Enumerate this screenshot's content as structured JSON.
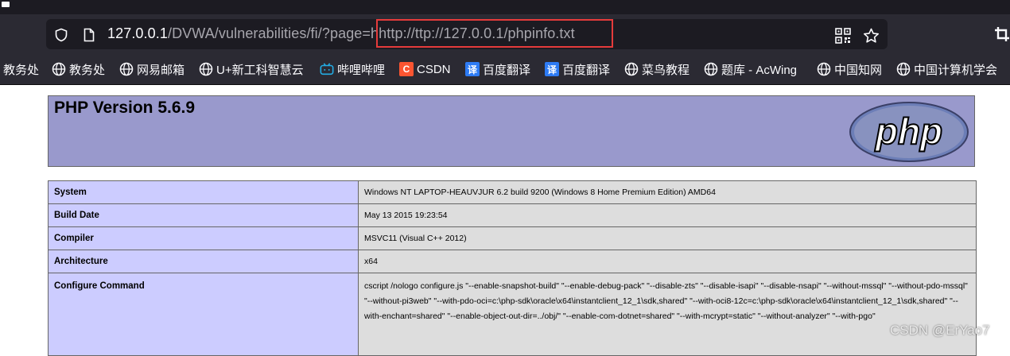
{
  "browser": {
    "url": {
      "host": "127.0.0.1",
      "path": "/DVWA/vulnerabilities/fi/?page=",
      "param": "hhttp://ttp://127.0.0.1/phpinfo.txt"
    },
    "icons": [
      "shield-icon",
      "page-icon",
      "qr-code-icon",
      "bookmark-star-icon",
      "screenshot-icon"
    ],
    "highlight_color": "#e53b3b"
  },
  "bookmarks": [
    {
      "label": "教务处",
      "icon": "none"
    },
    {
      "label": "教务处",
      "icon": "globe-icon"
    },
    {
      "label": "网易邮箱",
      "icon": "globe-icon"
    },
    {
      "label": "U+新工科智慧云",
      "icon": "globe-icon"
    },
    {
      "label": "哔哩哔哩",
      "icon": "bilibili-icon"
    },
    {
      "label": "CSDN",
      "icon": "csdn-icon"
    },
    {
      "label": "百度翻译",
      "icon": "translate-icon"
    },
    {
      "label": "百度翻译",
      "icon": "translate-icon"
    },
    {
      "label": "菜鸟教程",
      "icon": "globe-icon"
    },
    {
      "label": "题库 - AcWing",
      "icon": "globe-icon"
    },
    {
      "label": "中国知网",
      "icon": "globe-icon"
    },
    {
      "label": "中国计算机学会",
      "icon": "globe-icon"
    }
  ],
  "bookmark_glyphs": {
    "translate": "译",
    "csdn": "C"
  },
  "phpinfo": {
    "title": "PHP Version 5.6.9",
    "logo_text": "php",
    "header_color": "#9999cc",
    "rows": [
      {
        "key": "System",
        "value": "Windows NT LAPTOP-HEAUVJUR 6.2 build 9200 (Windows 8 Home Premium Edition) AMD64"
      },
      {
        "key": "Build Date",
        "value": "May 13 2015 19:23:54"
      },
      {
        "key": "Compiler",
        "value": "MSVC11 (Visual C++ 2012)"
      },
      {
        "key": "Architecture",
        "value": "x64"
      },
      {
        "key": "Configure Command",
        "value": "cscript /nologo configure.js \"--enable-snapshot-build\" \"--enable-debug-pack\" \"--disable-zts\" \"--disable-isapi\" \"--disable-nsapi\" \"--without-mssql\" \"--without-pdo-mssql\" \"--without-pi3web\" \"--with-pdo-oci=c:\\php-sdk\\oracle\\x64\\instantclient_12_1\\sdk,shared\" \"--with-oci8-12c=c:\\php-sdk\\oracle\\x64\\instantclient_12_1\\sdk,shared\" \"--with-enchant=shared\" \"--enable-object-out-dir=../obj/\" \"--enable-com-dotnet=shared\" \"--with-mcrypt=static\" \"--without-analyzer\" \"--with-pgo\""
      }
    ]
  },
  "watermark": "CSDN @ErYao7"
}
